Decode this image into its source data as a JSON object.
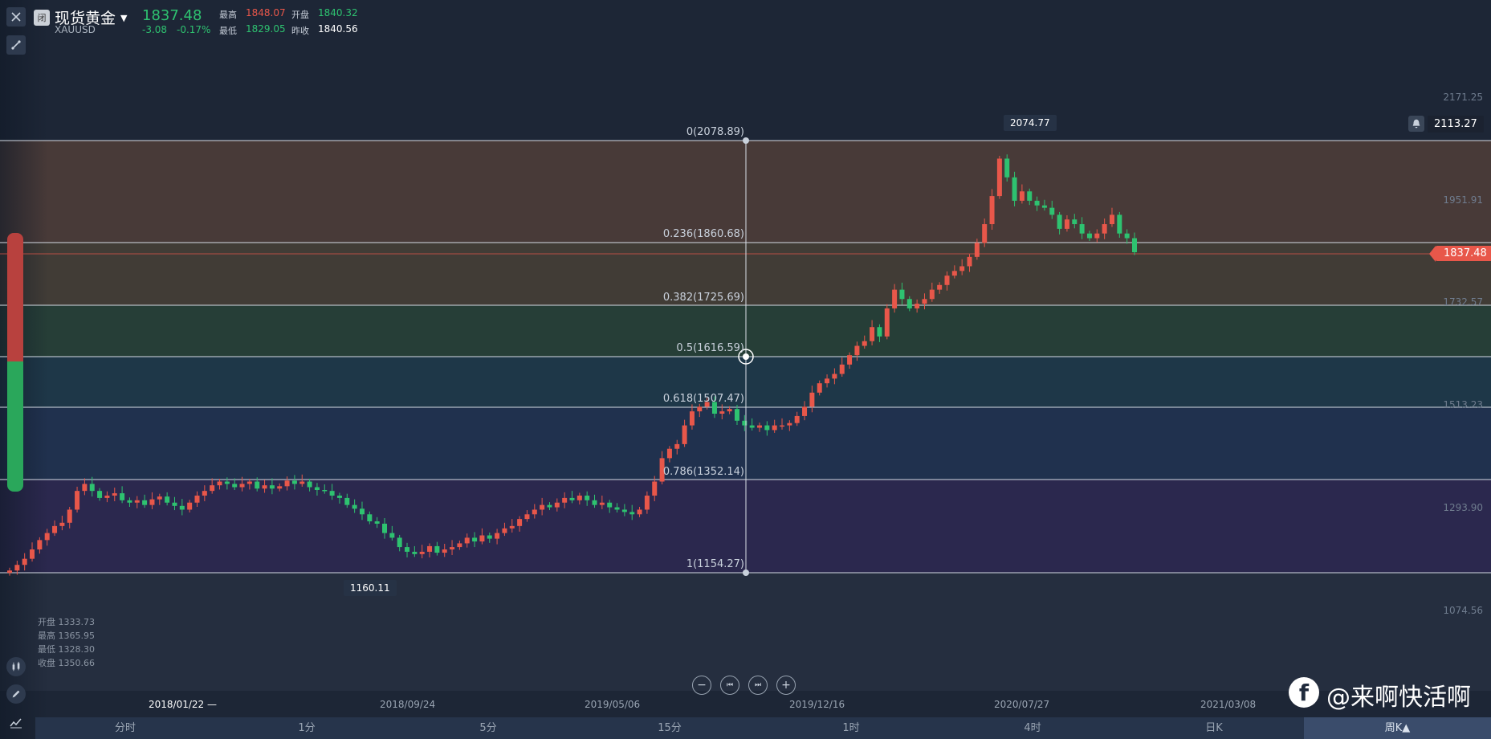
{
  "header": {
    "badge": "闭",
    "name": "现货黄金",
    "code": "XAUUSD",
    "price": "1837.48",
    "change": "-3.08",
    "change_pct": "-0.17%",
    "high_label": "最高",
    "high_value": "1848.07",
    "open_label": "开盘",
    "open_value": "1840.32",
    "low_label": "最低",
    "low_value": "1829.05",
    "prev_label": "昨收",
    "prev_value": "1840.56"
  },
  "price_axis": [
    "2171.25",
    "1951.91",
    "1732.57",
    "1513.23",
    "1293.90",
    "1074.56"
  ],
  "alert_price": "2113.27",
  "current_price_tag": "1837.48",
  "peak_label": "2074.77",
  "trough_label": "1160.11",
  "fib_levels": [
    {
      "label": "0(2078.89)",
      "color": "#6b4a3a"
    },
    {
      "label": "0.236(1860.68)",
      "color": "#5e4f36"
    },
    {
      "label": "0.382(1725.69)",
      "color": "#2d5238"
    },
    {
      "label": "0.5(1616.59)",
      "color": "#1f4658"
    },
    {
      "label": "0.618(1507.47)",
      "color": "#223a63"
    },
    {
      "label": "0.786(1352.14)",
      "color": "#372a63"
    },
    {
      "label": "1(1154.27)",
      "color": "#2b3547"
    }
  ],
  "ohlc": {
    "open": "开盘 1333.73",
    "high": "最高 1365.95",
    "low": "最低 1328.30",
    "close": "收盘 1350.66"
  },
  "time_axis": [
    "2018/01/22 —",
    "2018/09/24",
    "2019/05/06",
    "2019/12/16",
    "2020/07/27",
    "2021/03/08"
  ],
  "periods": [
    "分时",
    "1分",
    "5分",
    "15分",
    "1时",
    "4时",
    "日K",
    "周K▲"
  ],
  "watermark": "@来啊快活啊",
  "colors": {
    "up": "#e8574a",
    "down": "#2ec270"
  },
  "chart_data": {
    "type": "candlestick",
    "ylim": [
      1074.56,
      2171.25
    ],
    "series": [
      {
        "values": [
          1160,
          1172,
          1185,
          1205,
          1225,
          1240,
          1255,
          1262,
          1290,
          1330,
          1345,
          1330,
          1315,
          1320,
          1325,
          1310,
          1305,
          1310,
          1300,
          1312,
          1318,
          1305,
          1298,
          1290,
          1305,
          1320,
          1330,
          1342,
          1350,
          1345,
          1338,
          1345,
          1350,
          1335,
          1342,
          1335,
          1340,
          1352,
          1345,
          1350,
          1338,
          1332,
          1330,
          1320,
          1315,
          1300,
          1292,
          1280,
          1265,
          1260,
          1240,
          1230,
          1210,
          1200,
          1195,
          1200,
          1212,
          1198,
          1205,
          1210,
          1218,
          1230,
          1222,
          1235,
          1228,
          1240,
          1250,
          1255,
          1270,
          1280,
          1290,
          1300,
          1295,
          1305,
          1315,
          1310,
          1320,
          1310,
          1300,
          1305,
          1295,
          1290,
          1285,
          1280,
          1290,
          1320,
          1350,
          1400,
          1420,
          1430,
          1470,
          1500,
          1510,
          1520,
          1495,
          1500,
          1505,
          1480,
          1470,
          1465,
          1470,
          1460,
          1470,
          1470,
          1475,
          1490,
          1510,
          1540,
          1560,
          1570,
          1580,
          1600,
          1620,
          1640,
          1650,
          1680,
          1660,
          1720,
          1760,
          1740,
          1720,
          1730,
          1740,
          1760,
          1770,
          1790,
          1800,
          1810,
          1830,
          1860,
          1900,
          1960,
          2040,
          2000,
          1950,
          1970,
          1950,
          1940,
          1935,
          1920,
          1890,
          1910,
          1900,
          1880,
          1870,
          1880,
          1900,
          1920,
          1880,
          1870,
          1840
        ]
      }
    ]
  }
}
